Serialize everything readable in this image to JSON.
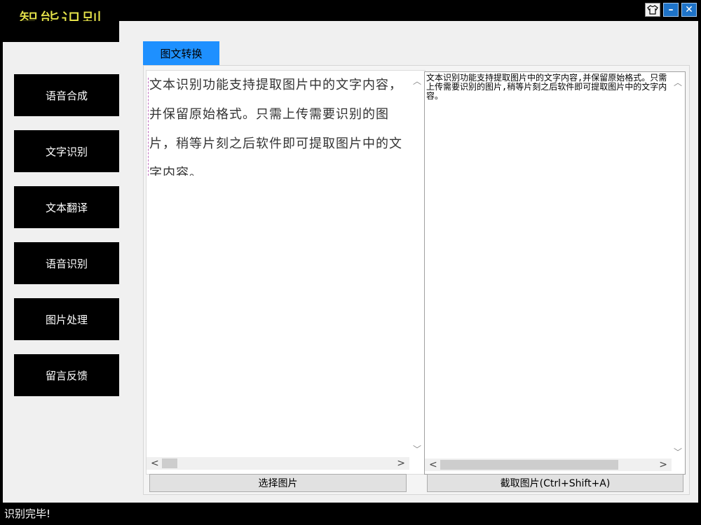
{
  "app": {
    "title": "智能识别"
  },
  "window_controls": {
    "skin_icon": "shirt-icon",
    "minimize": "–",
    "close": "✕"
  },
  "sidebar": {
    "items": [
      {
        "label": "语音合成"
      },
      {
        "label": "文字识别"
      },
      {
        "label": "文本翻译"
      },
      {
        "label": "语音识别"
      },
      {
        "label": "图片处理"
      },
      {
        "label": "留言反馈"
      }
    ]
  },
  "tabs": [
    {
      "label": "图文转换",
      "active": true
    }
  ],
  "left_pane": {
    "text": "文本识别功能支持提取图片中的文字内容，并保留原始格式。只需上传需要识别的图片，稍等片刻之后软件即可提取图片中的文字内容。"
  },
  "right_pane": {
    "text": "文本识别功能支持提取图片中的文字内容,并保留原始格式。只需上传需要识别的图片,稍等片刻之后软件即可提取图片中的文字内容。"
  },
  "buttons": {
    "select_image": "选择图片",
    "capture_image": "截取图片(Ctrl+Shift+A)"
  },
  "status": {
    "text": "识别完毕!"
  },
  "colors": {
    "accent": "#1e90ff",
    "title": "#e6e34a"
  }
}
